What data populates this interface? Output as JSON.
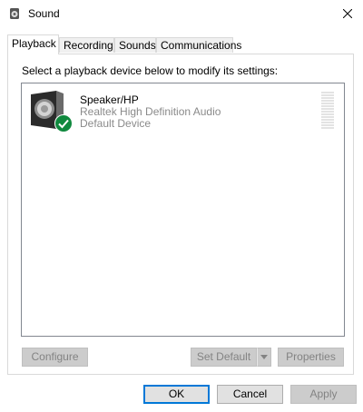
{
  "window": {
    "title": "Sound",
    "title_icon": "speaker-icon",
    "close_icon": "close-icon"
  },
  "tabs": [
    {
      "label": "Playback",
      "active": true
    },
    {
      "label": "Recording",
      "active": false
    },
    {
      "label": "Sounds",
      "active": false
    },
    {
      "label": "Communications",
      "active": false
    }
  ],
  "playback": {
    "instruction": "Select a playback device below to modify its settings:",
    "devices": [
      {
        "name": "Speaker/HP",
        "description": "Realtek High Definition Audio",
        "status": "Default Device",
        "icon": "speaker-icon",
        "status_icon": "checkmark-icon"
      }
    ],
    "buttons": {
      "configure": "Configure",
      "set_default": "Set Default",
      "properties": "Properties"
    }
  },
  "footer": {
    "ok": "OK",
    "cancel": "Cancel",
    "apply": "Apply"
  },
  "colors": {
    "accent": "#0078d7",
    "default_badge": "#10893e",
    "disabled_text": "#838383"
  }
}
